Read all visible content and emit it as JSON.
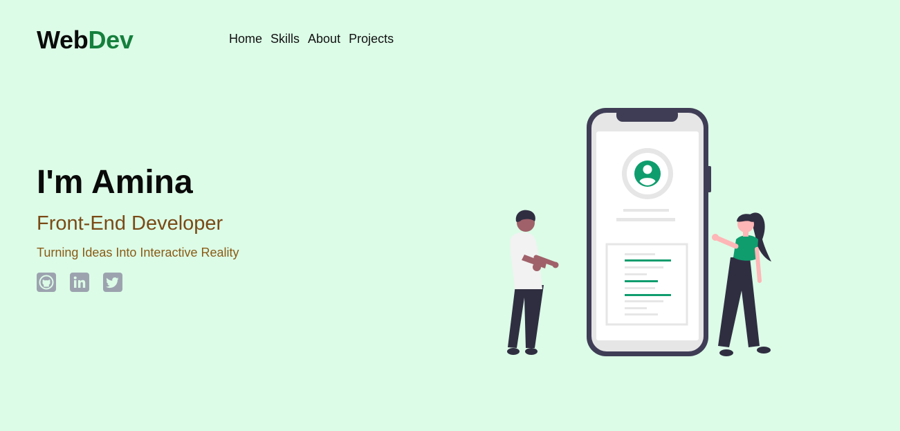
{
  "header": {
    "logo_part1": "Web",
    "logo_part2": "Dev",
    "nav": [
      {
        "label": "Home"
      },
      {
        "label": "Skills"
      },
      {
        "label": "About"
      },
      {
        "label": "Projects"
      }
    ]
  },
  "hero": {
    "name": "I'm Amina",
    "role": "Front-End Developer",
    "tagline": "Turning Ideas Into Interactive Reality"
  },
  "socials": [
    {
      "icon": "github-icon"
    },
    {
      "icon": "linkedin-icon"
    },
    {
      "icon": "twitter-icon"
    }
  ],
  "colors": {
    "background": "#dcfce7",
    "accent_green": "#15803d",
    "role_brown": "#7a4a16",
    "icon_gray": "#9ca3af",
    "phone_frame": "#3f3d56",
    "illustration_green": "#0f9d6e"
  }
}
